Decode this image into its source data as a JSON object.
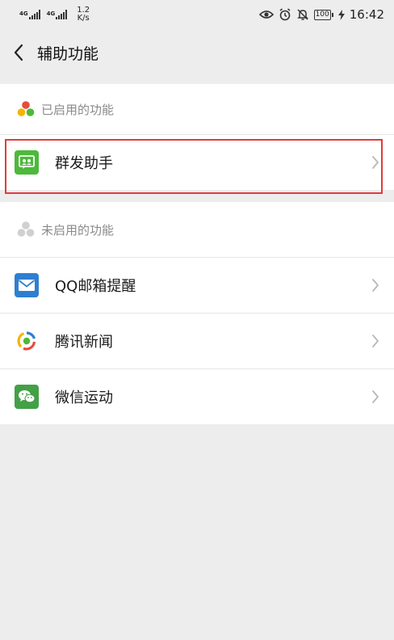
{
  "status_bar": {
    "network1": "4G",
    "network2": "4G",
    "speed_value": "1.2",
    "speed_unit": "K/s",
    "battery": "100",
    "time": "16:42"
  },
  "header": {
    "title": "辅助功能"
  },
  "enabled_section": {
    "label": "已启用的功能",
    "items": [
      {
        "label": "群发助手",
        "icon": "broadcast-assistant-icon",
        "color": "#4cb93a"
      }
    ]
  },
  "disabled_section": {
    "label": "未启用的功能",
    "items": [
      {
        "label": "QQ邮箱提醒",
        "icon": "mail-icon",
        "color": "#2e7fd0"
      },
      {
        "label": "腾讯新闻",
        "icon": "tencent-news-icon",
        "color": "#ffffff"
      },
      {
        "label": "微信运动",
        "icon": "wechat-sports-icon",
        "color": "#43a047"
      }
    ]
  },
  "colors": {
    "highlight": "#e33b3b",
    "background": "#ededed"
  }
}
